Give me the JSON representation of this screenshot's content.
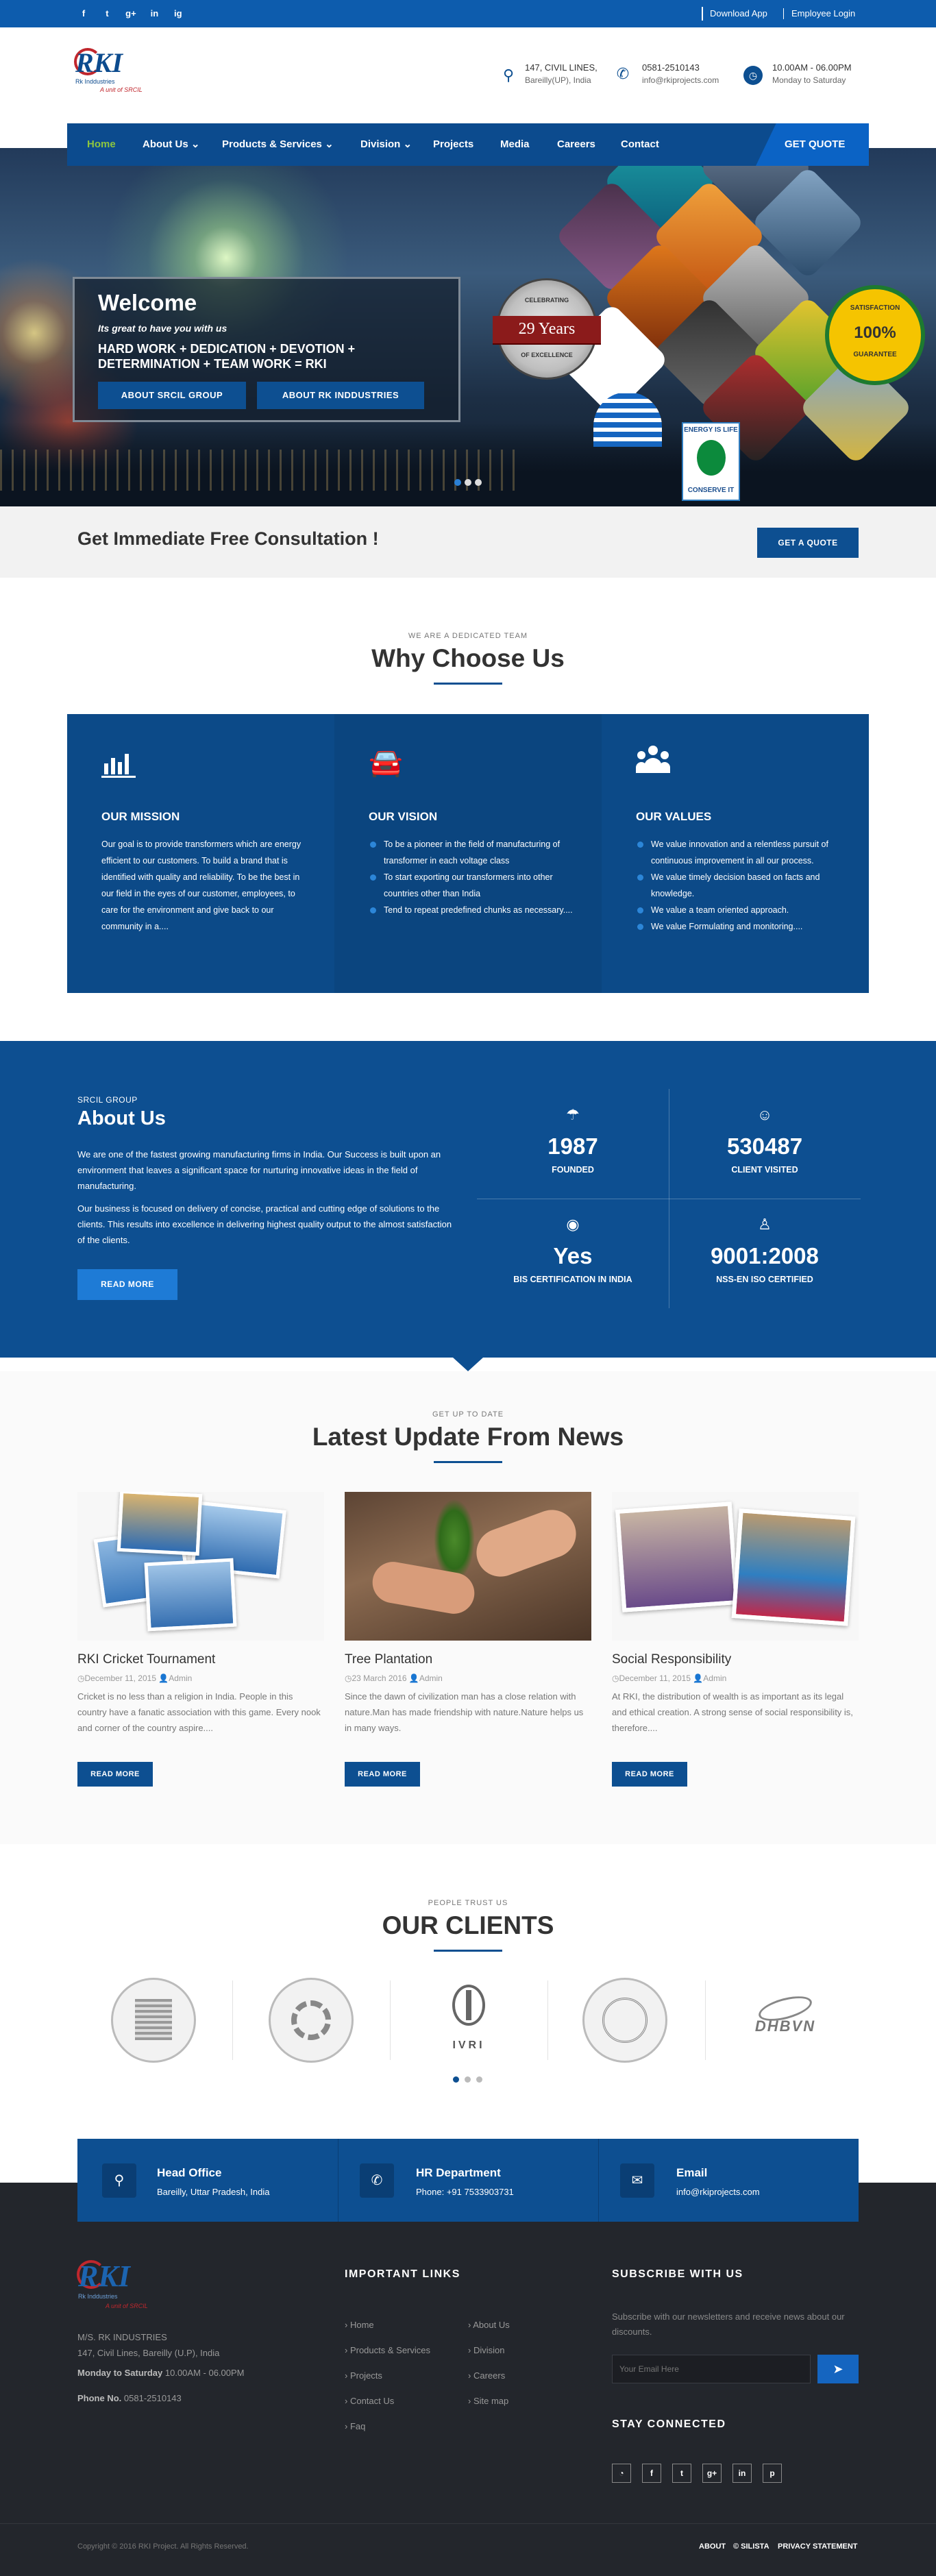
{
  "topbar": {
    "social": [
      "f",
      "t",
      "g+",
      "in",
      "ig"
    ],
    "download_app": "Download App",
    "employee_login": "Employee Login"
  },
  "header": {
    "logo_text": "RKI",
    "logo_sub1": "Rk Inddustries",
    "logo_sub2": "A unit of SRCIL",
    "address_line1": "147, CIVIL LINES,",
    "address_line2": "Bareilly(UP), India",
    "phone": "0581-2510143",
    "email": "info@rkiprojects.com",
    "hours": "10.00AM - 06.00PM",
    "days": "Monday to Saturday"
  },
  "nav": {
    "items": [
      "Home",
      "About Us",
      "Products & Services",
      "Division",
      "Projects",
      "Media",
      "Careers",
      "Contact"
    ],
    "quote": "GET QUOTE"
  },
  "hero": {
    "welcome": "Welcome",
    "tagline": "Its great to have you with us",
    "motto1": "HARD WORK + DEDICATION + DEVOTION +",
    "motto2": "DETERMINATION + TEAM WORK = RKI",
    "btn1": "ABOUT SRCIL GROUP",
    "btn2": "ABOUT RK INDDUSTRIES",
    "badge_years": "29 Years",
    "badge_years_top": "CELEBRATING",
    "badge_years_bottom": "OF EXCELLENCE",
    "badge_sat_top": "SATISFACTION",
    "badge_sat_pct": "100%",
    "badge_sat_bottom": "GUARANTEE",
    "energy1": "ENERGY IS LIFE",
    "energy2": "CONSERVE IT",
    "slides": 3,
    "active_slide": 1
  },
  "consult": {
    "title": "Get Immediate Free Consultation !",
    "btn": "GET A QUOTE"
  },
  "why": {
    "sub": "WE ARE A DEDICATED TEAM",
    "title": "Why Choose Us",
    "cards": [
      {
        "title": "OUR MISSION",
        "text": "Our goal is to provide transformers which are energy efficient to our customers. To build a brand that is identified with quality and reliability. To be the best in our field in the eyes of our customer, employees, to care for the environment and give back to our community in a...."
      },
      {
        "title": "OUR VISION",
        "items": [
          "To be a pioneer in the field of manufacturing of transformer in each voltage class",
          "To start exporting our transformers into other countries other than India",
          "Tend to repeat predefined chunks as necessary...."
        ]
      },
      {
        "title": "OUR VALUES",
        "items": [
          "We value innovation and a relentless pursuit of continuous improvement in all our process.",
          "We value timely decision based on facts and knowledge.",
          "We value a team oriented approach.",
          "We value Formulating and monitoring...."
        ]
      }
    ]
  },
  "about": {
    "sub": "SRCIL GROUP",
    "title": "About Us",
    "p1": "We are one of the fastest growing manufacturing firms in India. Our Success is built upon an environment that leaves a significant space for nurturing innovative ideas in the field of manufacturing.",
    "p2": "Our business is focused on delivery of concise, practical and cutting edge of solutions to the clients. This results into excellence in delivering highest quality output to the almost satisfaction of the clients.",
    "btn": "READ MORE",
    "stats": [
      {
        "value": "1987",
        "label": "FOUNDED"
      },
      {
        "value": "530487",
        "label": "CLIENT VISITED"
      },
      {
        "value": "Yes",
        "label": "BIS CERTIFICATION IN INDIA"
      },
      {
        "value": "9001:2008",
        "label": "NSS-EN ISO CERTIFIED"
      }
    ]
  },
  "news": {
    "sub": "GET UP TO DATE",
    "title": "Latest Update From News",
    "items": [
      {
        "title": "RKI Cricket Tournament",
        "date": "December 11, 2015",
        "author": "Admin",
        "text": "Cricket is no less than a religion in India. People in this country have a fanatic association with this game. Every nook and corner of the country aspire....",
        "btn": "READ MORE"
      },
      {
        "title": "Tree Plantation",
        "date": "23 March 2016",
        "author": "Admin",
        "text": "Since the dawn of civilization man has a close relation with nature.Man has made friendship with nature.Nature helps us in many ways.",
        "btn": "READ MORE"
      },
      {
        "title": "Social Responsibility",
        "date": "December 11, 2015",
        "author": "Admin",
        "text": "At RKI, the distribution of wealth is as important as its legal and ethical creation. A strong sense of social responsibility is, therefore....",
        "btn": "READ MORE"
      }
    ]
  },
  "clients": {
    "sub": "PEOPLE TRUST US",
    "title": "OUR CLIENTS",
    "logos": [
      "",
      "",
      "IVRI",
      "",
      "DHBVN"
    ],
    "active_dot": 0
  },
  "contact": [
    {
      "title": "Head Office",
      "text": "Bareilly, Uttar Pradesh, India"
    },
    {
      "title": "HR Department",
      "text": "Phone: +91 7533903731"
    },
    {
      "title": "Email",
      "text": "info@rkiprojects.com"
    }
  ],
  "footer": {
    "company": "M/S. RK INDUSTRIES",
    "address": "147, Civil Lines, Bareilly (U.P), India",
    "hours_label": "Monday to Saturday",
    "hours": "10.00AM - 06.00PM",
    "phone_label": "Phone No.",
    "phone": "0581-2510143",
    "links_title": "IMPORTANT LINKS",
    "links_col1": [
      "Home",
      "Products & Services",
      "Projects",
      "Contact Us",
      "Faq"
    ],
    "links_col2": [
      "About Us",
      "Division",
      "Careers",
      "Site map"
    ],
    "subscribe_title": "SUBSCRIBE WITH US",
    "subscribe_text": "Subscribe with our newsletters and receive news about our discounts.",
    "email_placeholder": "Your Email Here",
    "connected_title": "STAY CONNECTED",
    "copyright": "Copyright © 2016 RKI Project. All Rights Reserved.",
    "bottom_links": [
      "ABOUT",
      "© SILISTA",
      "PRIVACY STATEMENT"
    ]
  },
  "colors": {
    "primary": "#0d4f91",
    "topbar": "#0d5cad",
    "footer": "#23262c",
    "accent_green": "#7ac143"
  }
}
